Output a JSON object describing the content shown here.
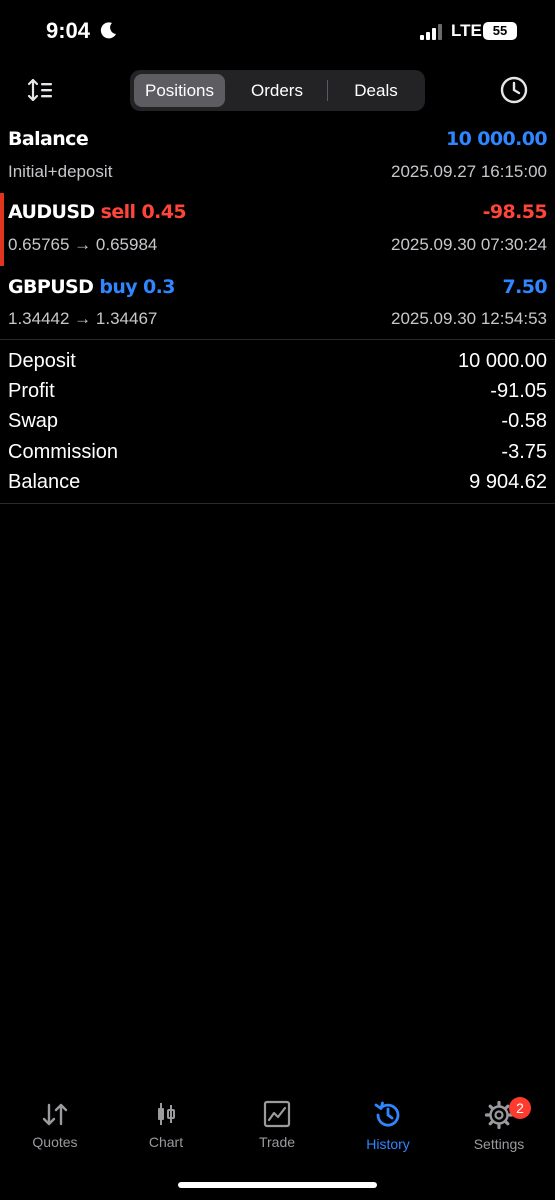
{
  "status_bar": {
    "time": "9:04",
    "network": "LTE",
    "battery": "55"
  },
  "tabs_segment": [
    "Positions",
    "Orders",
    "Deals"
  ],
  "balance_row": {
    "title": "Balance",
    "value": "10 000.00",
    "subtitle": "Initial+deposit",
    "date": "2025.09.27 16:15:00"
  },
  "positions": [
    {
      "symbol": "AUDUSD",
      "side": "sell",
      "volume": "0.45",
      "profit": "-98.55",
      "prices": "0.65765 → 0.65984",
      "date": "2025.09.30 07:30:24",
      "color": "#ff453a"
    },
    {
      "symbol": "GBPUSD",
      "side": "buy",
      "volume": "0.3",
      "profit": "7.50",
      "prices": "1.34442 → 1.34467",
      "date": "2025.09.30 12:54:53",
      "color": "#2f86ff"
    }
  ],
  "summary": [
    {
      "label": "Deposit",
      "value": "10 000.00"
    },
    {
      "label": "Profit",
      "value": "-91.05"
    },
    {
      "label": "Swap",
      "value": "-0.58"
    },
    {
      "label": "Commission",
      "value": "-3.75"
    },
    {
      "label": "Balance",
      "value": "9 904.62"
    }
  ],
  "bottom_tabs": [
    {
      "label": "Quotes",
      "icon": "quotes-icon"
    },
    {
      "label": "Chart",
      "icon": "chart-icon"
    },
    {
      "label": "Trade",
      "icon": "trade-icon"
    },
    {
      "label": "History",
      "icon": "history-icon"
    },
    {
      "label": "Settings",
      "icon": "gear-icon"
    }
  ],
  "active_tab": "History",
  "settings_badge": "2",
  "colors": {
    "accent": "#2f86ff",
    "loss": "#ff453a",
    "background": "#000000"
  }
}
